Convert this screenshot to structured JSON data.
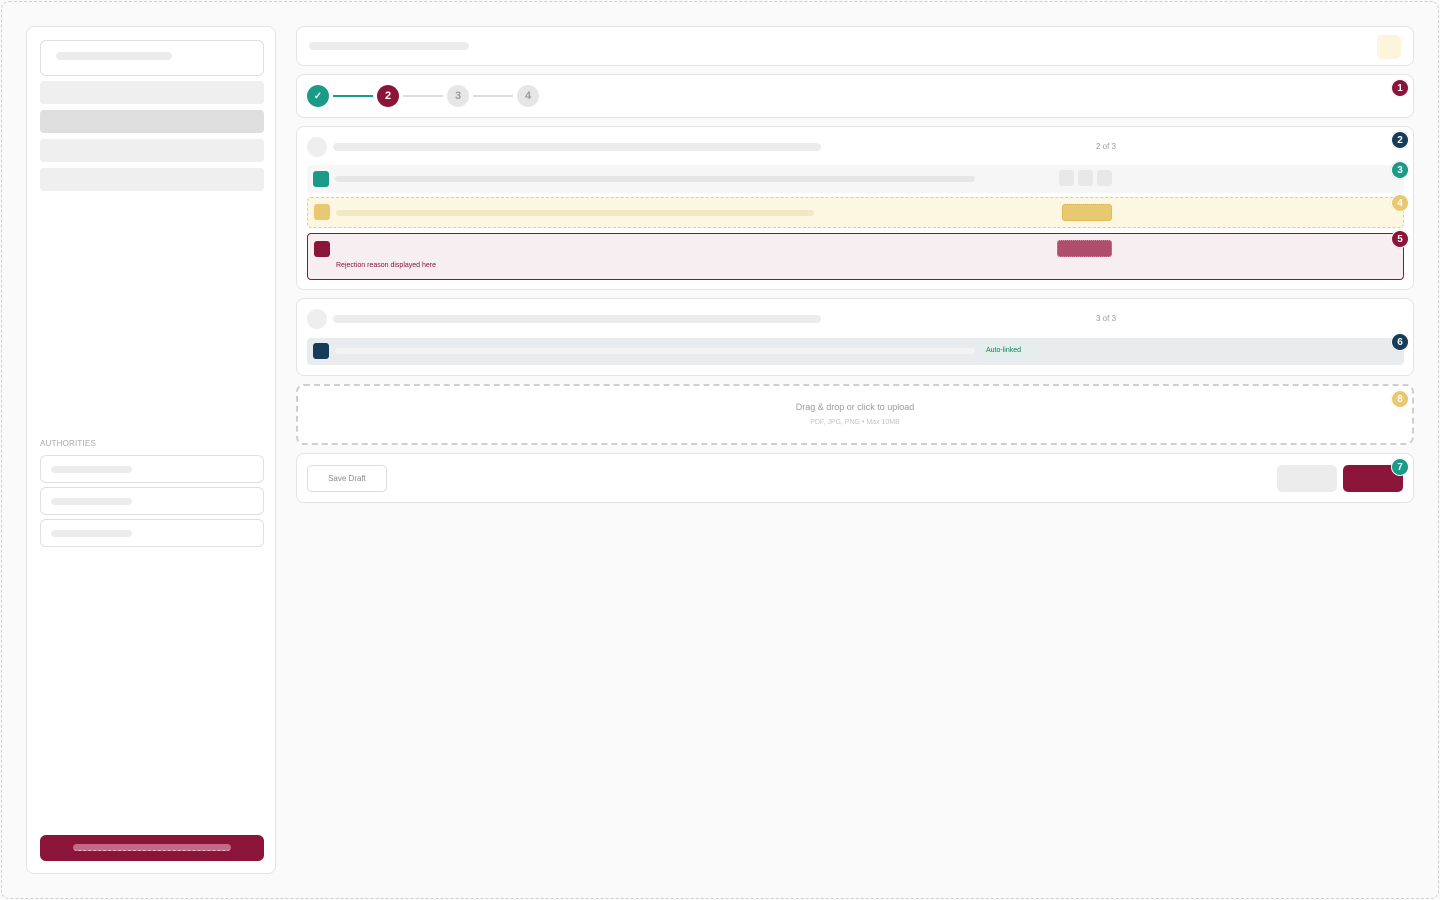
{
  "colors": {
    "primary": "#8b1538",
    "success": "#1a9a87",
    "warning": "#e8c870",
    "info": "#153d5a"
  },
  "sidebar": {
    "section_label": "AUTHORITIES"
  },
  "stepper": {
    "steps": [
      {
        "label": "✓",
        "state": "done"
      },
      {
        "label": "2",
        "state": "current"
      },
      {
        "label": "3",
        "state": "pending"
      },
      {
        "label": "4",
        "state": "pending"
      }
    ]
  },
  "section_one": {
    "count": "2 of 3",
    "rows": {
      "rejected": {
        "reason": "Rejection reason displayed here"
      }
    }
  },
  "section_two": {
    "count": "3 of 3",
    "rows": {
      "linked": {
        "tag": "Auto-linked"
      }
    }
  },
  "upload": {
    "title": "Drag & drop or click to upload",
    "hint": "PDF, JPG, PNG • Max 10MB"
  },
  "actions": {
    "save_draft": "Save Draft"
  },
  "markers": [
    {
      "label": "1",
      "color": "#8b1538"
    },
    {
      "label": "2",
      "color": "#153d5a"
    },
    {
      "label": "3",
      "color": "#1a9a87"
    },
    {
      "label": "4",
      "color": "#e8c870"
    },
    {
      "label": "5",
      "color": "#8b1538"
    },
    {
      "label": "6",
      "color": "#153d5a"
    },
    {
      "label": "7",
      "color": "#1a9a87"
    },
    {
      "label": "8",
      "color": "#e8c870"
    }
  ]
}
